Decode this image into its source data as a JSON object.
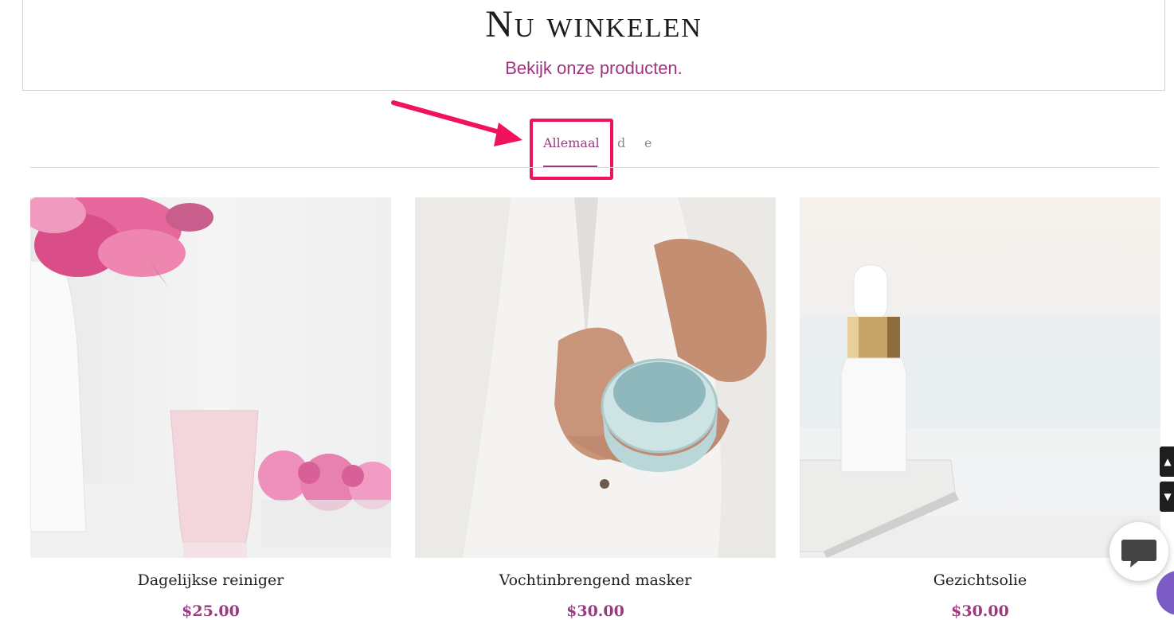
{
  "header": {
    "title": "Nu winkelen",
    "subtitle": "Bekijk onze producten."
  },
  "tabs": [
    {
      "label": "Allemaal",
      "active": true
    },
    {
      "label": "d",
      "active": false
    },
    {
      "label": "e",
      "active": false
    }
  ],
  "products": [
    {
      "name": "Dagelijkse reiniger",
      "price": "$25.00"
    },
    {
      "name": "Vochtinbrengend masker",
      "price": "$30.00"
    },
    {
      "name": "Gezichtsolie",
      "price": "$30.00"
    }
  ],
  "colors": {
    "accent": "#9a3b82",
    "highlight": "#f0125f",
    "purple_button": "#7b5cc4"
  },
  "icons": {
    "chat": "chat-bubble-icon",
    "scroll_up": "chevron-up-icon",
    "scroll_down": "chevron-down-icon"
  }
}
